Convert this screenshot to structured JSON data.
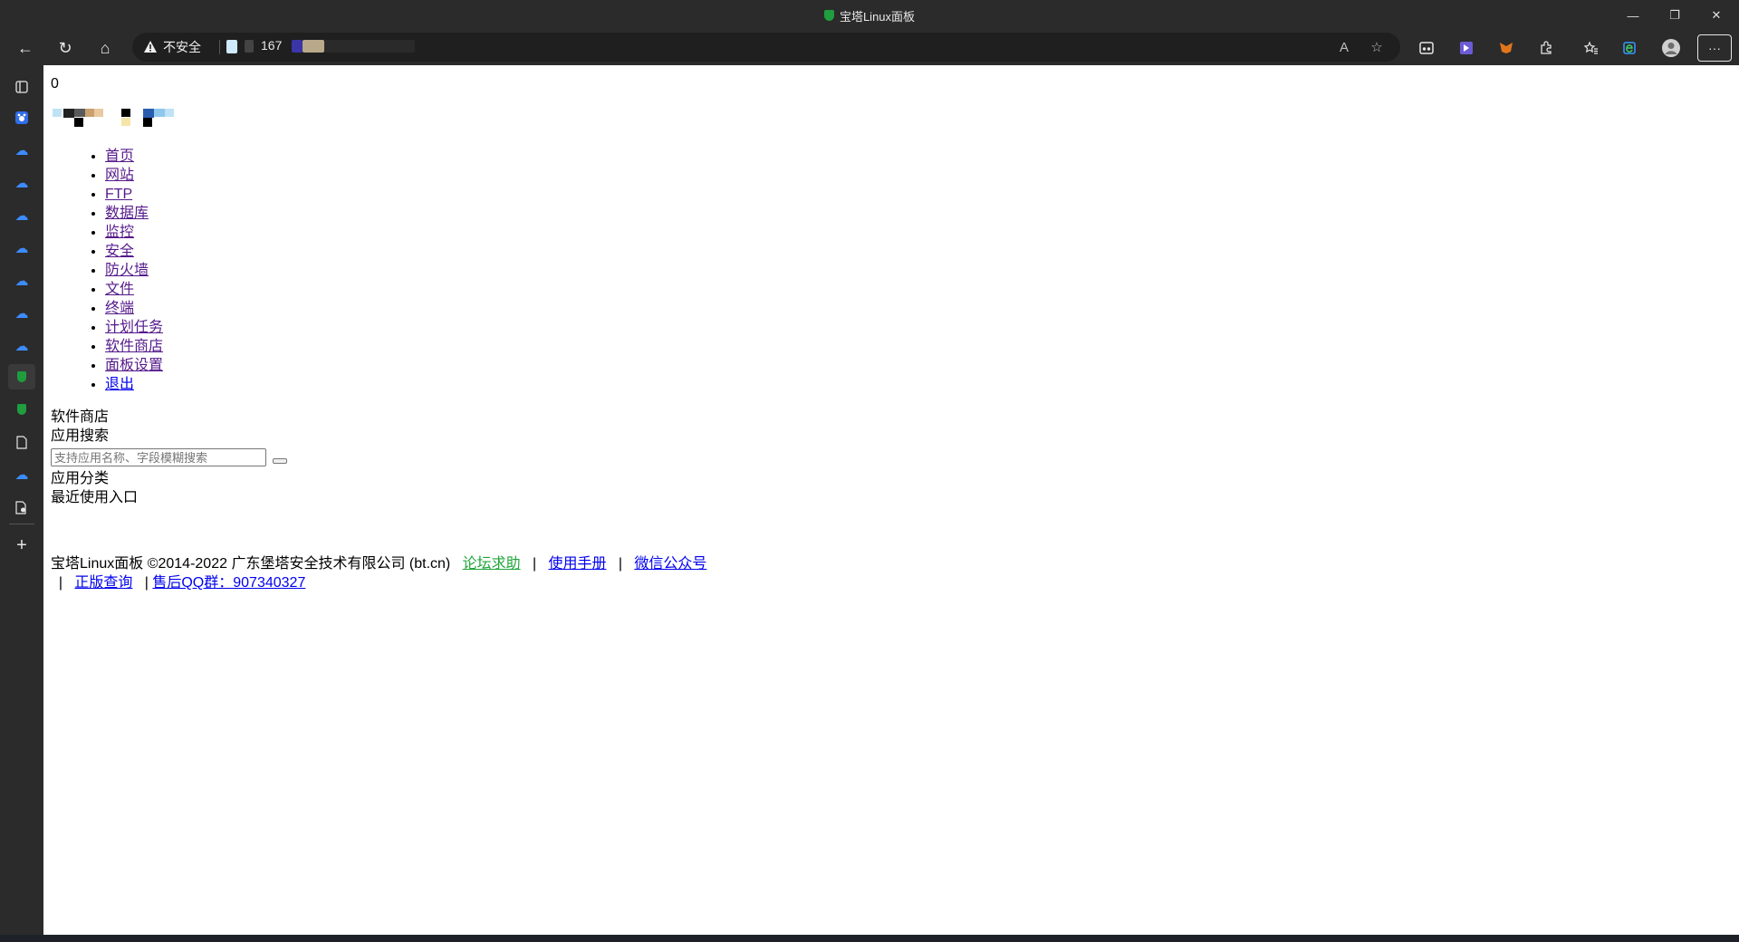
{
  "window": {
    "title": "宝塔Linux面板",
    "minimize_glyph": "—",
    "maximize_glyph": "❐",
    "close_glyph": "✕"
  },
  "toolbar": {
    "back_glyph": "←",
    "refresh_glyph": "↻",
    "home_glyph": "⌂",
    "security_label": "不安全",
    "url_fragment": "167",
    "read_aloud_glyph": "A",
    "favorite_glyph": "☆",
    "more_glyph": "···"
  },
  "page": {
    "counter": "0",
    "nav": [
      {
        "label": "首页",
        "visited": true
      },
      {
        "label": "网站",
        "visited": true
      },
      {
        "label": "FTP",
        "visited": true
      },
      {
        "label": "数据库",
        "visited": true
      },
      {
        "label": "监控",
        "visited": true
      },
      {
        "label": "安全",
        "visited": true
      },
      {
        "label": "防火墙",
        "visited": true
      },
      {
        "label": "文件",
        "visited": true
      },
      {
        "label": "终端",
        "visited": true
      },
      {
        "label": "计划任务",
        "visited": true
      },
      {
        "label": "软件商店",
        "visited": true
      },
      {
        "label": "面板设置",
        "visited": true
      },
      {
        "label": "退出",
        "visited": false
      }
    ],
    "section_title": "软件商店",
    "search_label": "应用搜索",
    "search_placeholder": "支持应用名称、字段模糊搜索",
    "category_label": "应用分类",
    "recent_label": "最近使用入口"
  },
  "footer": {
    "copyright": "宝塔Linux面板 ©2014-2022 广东堡塔安全技术有限公司 (bt.cn)",
    "forum_link": "论坛求助",
    "manual_link": "使用手册",
    "wechat_link": "微信公众号",
    "verify_link": "正版查询",
    "qq_link": "售后QQ群：907340327",
    "separator": "|"
  },
  "colors": {
    "chrome_bg": "#2b2b2b",
    "link": "#0000ee",
    "visited_link": "#551a8b",
    "forum_link": "#20a53a",
    "bt_green": "#1f9d3f"
  }
}
